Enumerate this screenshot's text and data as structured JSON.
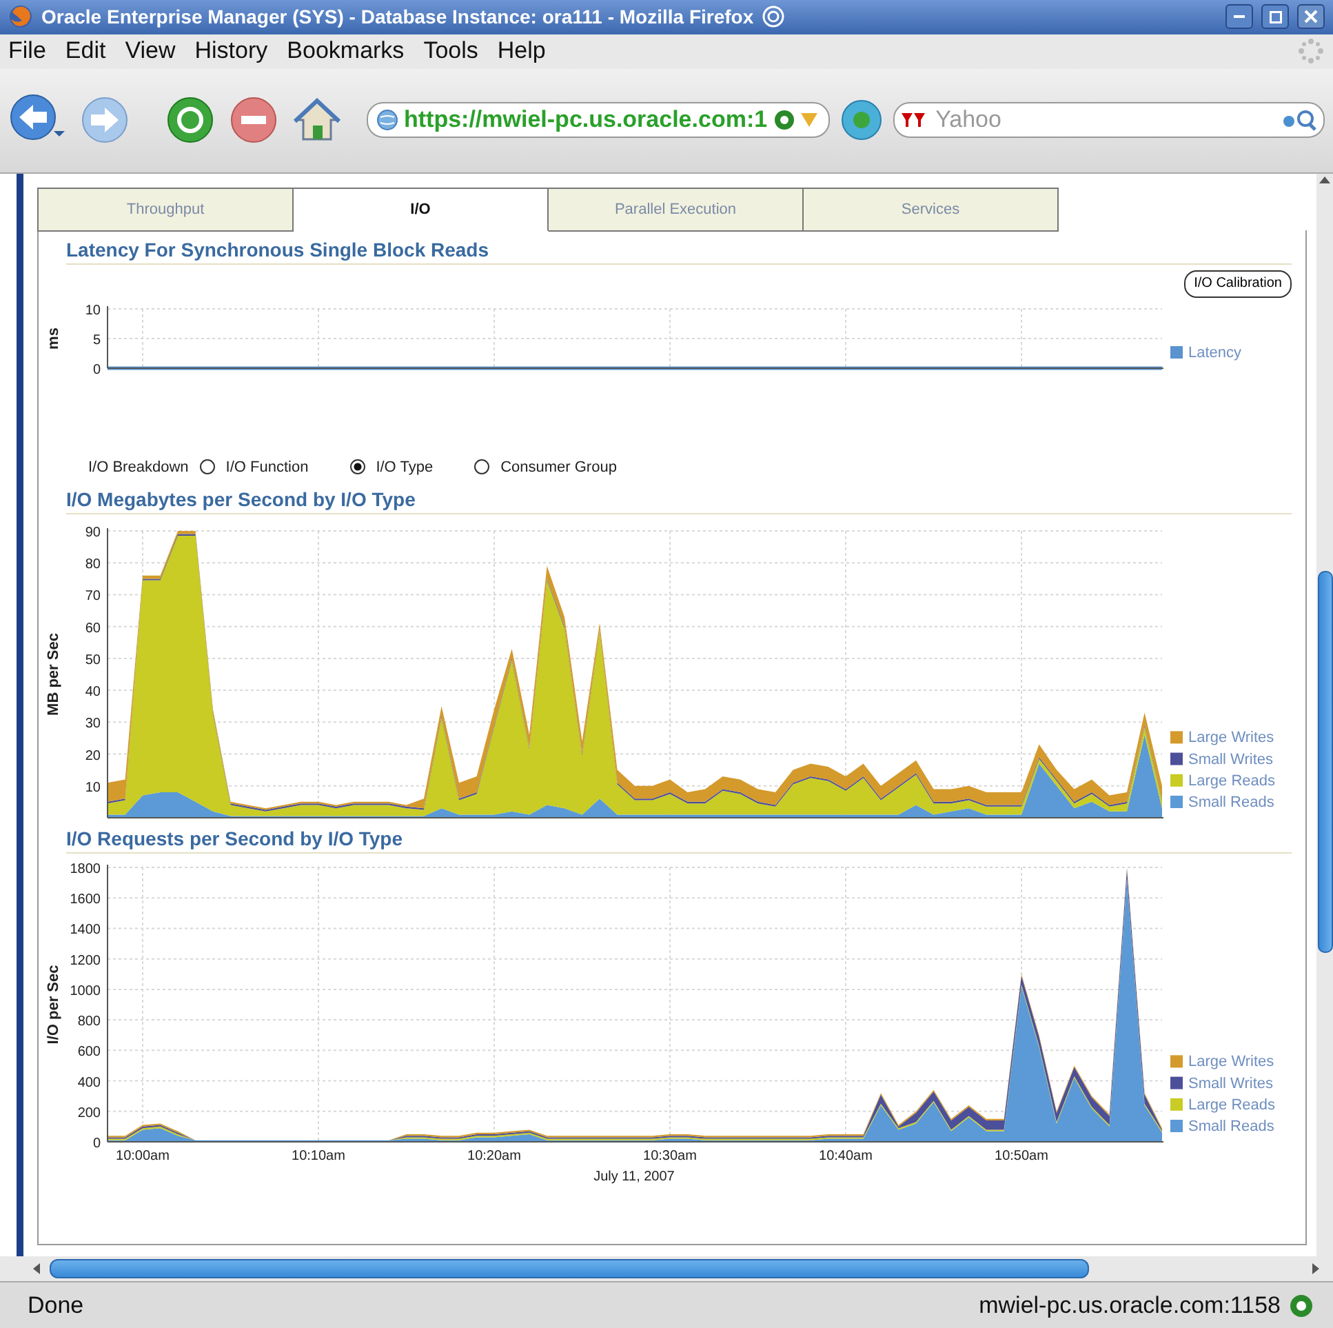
{
  "window": {
    "title": "Oracle Enterprise Manager (SYS) - Database Instance: ora111 - Mozilla Firefox"
  },
  "menu": [
    "File",
    "Edit",
    "View",
    "History",
    "Bookmarks",
    "Tools",
    "Help"
  ],
  "toolbar": {
    "url": "https://mwiel-pc.us.oracle.com:1",
    "search": {
      "placeholder": "Yahoo"
    }
  },
  "tabs": [
    {
      "label": "Throughput",
      "selected": false
    },
    {
      "label": "I/O",
      "selected": true
    },
    {
      "label": "Parallel Execution",
      "selected": false
    },
    {
      "label": "Services",
      "selected": false
    }
  ],
  "latency": {
    "title": "Latency For Synchronous Single Block Reads",
    "button": "I/O Calibration",
    "chart_data": {
      "type": "line",
      "ylabel": "ms",
      "categories": [
        null,
        null,
        null,
        null,
        null,
        null,
        null,
        null,
        null,
        null,
        null,
        null,
        null,
        null,
        null,
        null,
        null,
        null,
        null,
        null,
        null,
        null,
        null,
        null,
        null,
        null,
        null,
        null,
        null,
        null,
        null,
        null,
        null,
        null,
        null,
        null,
        null,
        null,
        null,
        null,
        null,
        null,
        null,
        null,
        null,
        null,
        null,
        null,
        null,
        null,
        null,
        null,
        null,
        null,
        null,
        null,
        null,
        null,
        null,
        null,
        null
      ],
      "ylim": [
        0,
        10
      ],
      "yticks": [
        0,
        5,
        10
      ],
      "grid": true,
      "legend": true,
      "series": [
        {
          "name": "Latency",
          "color": "#5b93d0",
          "values": [
            0,
            0,
            0,
            0,
            0,
            0,
            0,
            0,
            0,
            0,
            0,
            0,
            0,
            0,
            0,
            0,
            0,
            0,
            0,
            0,
            0,
            0,
            0,
            0,
            0,
            0,
            0,
            0,
            0,
            0,
            0,
            0,
            0,
            0,
            0,
            0,
            0,
            0,
            0,
            0,
            0,
            0,
            0,
            0,
            0,
            0,
            0,
            0,
            0,
            0,
            0,
            0,
            0,
            0,
            0,
            0,
            0,
            0,
            0,
            0,
            0
          ]
        }
      ]
    }
  },
  "breakdown": {
    "label": "I/O Breakdown",
    "options": [
      {
        "label": "I/O Function",
        "selected": false
      },
      {
        "label": "I/O Type",
        "selected": true
      },
      {
        "label": "Consumer Group",
        "selected": false
      }
    ]
  },
  "megabytes": {
    "title": "I/O Megabytes per Second by I/O Type",
    "chart_data": {
      "type": "area",
      "stacked": true,
      "ylabel": "MB per Sec",
      "ylim": [
        0,
        90
      ],
      "yticks": [
        10,
        20,
        30,
        40,
        50,
        60,
        70,
        80,
        90
      ],
      "grid": true,
      "legend": true,
      "categories": [
        null,
        null,
        null,
        null,
        null,
        null,
        null,
        null,
        null,
        null,
        null,
        null,
        null,
        null,
        null,
        null,
        null,
        null,
        null,
        null,
        null,
        null,
        null,
        null,
        null,
        null,
        null,
        null,
        null,
        null,
        null,
        null,
        null,
        null,
        null,
        null,
        null,
        null,
        null,
        null,
        null,
        null,
        null,
        null,
        null,
        null,
        null,
        null,
        null,
        null,
        null,
        null,
        null,
        null,
        null,
        null,
        null,
        null,
        null,
        null,
        null
      ],
      "series": [
        {
          "name": "Small Reads",
          "color": "#5b9ad6",
          "values": [
            1,
            1,
            7,
            8,
            8,
            5,
            2,
            0.5,
            0.5,
            0.5,
            0.5,
            0.5,
            0.5,
            0.5,
            0.5,
            0.5,
            0.5,
            0.5,
            0.5,
            3,
            1,
            1,
            1,
            2,
            1,
            4,
            3,
            1,
            6,
            1,
            1,
            1,
            1,
            1,
            1,
            1,
            1,
            1,
            1,
            1,
            1,
            1,
            1,
            1,
            1,
            1,
            4,
            1,
            2,
            3,
            1,
            1,
            1,
            17,
            10,
            3,
            5,
            2,
            2,
            26,
            3
          ]
        },
        {
          "name": "Large Reads",
          "color": "#c8cc24",
          "values": [
            3.5,
            4.5,
            67.5,
            66.5,
            80.5,
            83.5,
            30.5,
            3.5,
            2.5,
            1.5,
            2.5,
            3.5,
            3.5,
            2.5,
            3.5,
            3.5,
            3.5,
            2.5,
            2,
            28.5,
            4.5,
            6.5,
            27.5,
            47.5,
            20.5,
            70.5,
            56.5,
            18.5,
            52.5,
            9.5,
            4.5,
            4.5,
            6.5,
            3.5,
            3.5,
            7.5,
            6.5,
            3.5,
            2.5,
            9.5,
            11.5,
            10.5,
            7.5,
            11.5,
            4.5,
            8.5,
            9.5,
            3.5,
            2.5,
            2.5,
            2.5,
            2.5,
            2.5,
            1.5,
            1.5,
            1.5,
            2.5,
            1.5,
            2.5,
            2.5,
            2.5
          ]
        },
        {
          "name": "Small Writes",
          "color": "#4c4f99",
          "values": [
            0.5,
            0.5,
            0.5,
            0.5,
            0.5,
            0.5,
            0.5,
            0.5,
            0.5,
            0.5,
            0.5,
            0.5,
            0.5,
            0.5,
            0.5,
            0.5,
            0.5,
            0.5,
            0.5,
            0.5,
            0.5,
            0.5,
            0.5,
            0.5,
            0.5,
            0.5,
            0.5,
            0.5,
            0.5,
            0.5,
            0.5,
            0.5,
            0.5,
            0.5,
            0.5,
            0.5,
            0.5,
            0.5,
            0.5,
            0.5,
            0.5,
            0.5,
            0.5,
            0.5,
            0.5,
            0.5,
            0.5,
            0.5,
            0.5,
            0.5,
            0.5,
            0.5,
            0.5,
            0.5,
            0.5,
            0.5,
            0.5,
            0.5,
            0.5,
            0.5,
            0.5
          ]
        },
        {
          "name": "Large Writes",
          "color": "#d49a2c",
          "values": [
            6,
            6,
            1,
            1,
            1,
            1,
            1,
            0.5,
            0.5,
            0.5,
            0.5,
            0.5,
            0.5,
            0.5,
            0.5,
            0.5,
            0.5,
            0.5,
            3,
            3,
            5,
            5,
            5,
            3,
            4,
            4,
            3,
            4,
            2,
            4,
            4,
            4,
            4,
            3,
            4,
            4,
            4,
            4,
            4,
            4,
            4,
            4,
            4,
            4,
            4,
            4,
            4,
            4,
            4,
            4,
            4,
            4,
            4,
            4,
            3,
            4,
            4,
            3,
            3,
            4,
            4
          ]
        }
      ]
    }
  },
  "requests": {
    "title": "I/O Requests per Second by I/O Type",
    "chart_data": {
      "type": "area",
      "stacked": true,
      "ylabel": "I/O per Sec",
      "xlabel": "July 11, 2007",
      "ylim": [
        0,
        1800
      ],
      "yticks": [
        0,
        200,
        400,
        600,
        800,
        1000,
        1200,
        1400,
        1600,
        1800
      ],
      "grid": true,
      "legend": true,
      "categories": [
        null,
        null,
        "10:00am",
        null,
        null,
        null,
        null,
        null,
        null,
        null,
        null,
        null,
        "10:10am",
        null,
        null,
        null,
        null,
        null,
        null,
        null,
        null,
        null,
        "10:20am",
        null,
        null,
        null,
        null,
        null,
        null,
        null,
        null,
        null,
        "10:30am",
        null,
        null,
        null,
        null,
        null,
        null,
        null,
        null,
        null,
        "10:40am",
        null,
        null,
        null,
        null,
        null,
        null,
        null,
        null,
        null,
        "10:50am",
        null,
        null,
        null,
        null,
        null,
        null,
        null,
        null
      ],
      "series": [
        {
          "name": "Small Reads",
          "color": "#5b9ad6",
          "values": [
            10,
            10,
            80,
            90,
            40,
            10,
            10,
            10,
            10,
            10,
            10,
            10,
            10,
            10,
            10,
            10,
            10,
            20,
            20,
            10,
            10,
            30,
            30,
            40,
            50,
            10,
            10,
            10,
            10,
            10,
            10,
            10,
            20,
            20,
            10,
            10,
            10,
            10,
            10,
            10,
            10,
            20,
            20,
            20,
            240,
            80,
            120,
            260,
            70,
            160,
            70,
            70,
            1020,
            620,
            120,
            420,
            220,
            100,
            1720,
            240,
            60
          ]
        },
        {
          "name": "Large Reads",
          "color": "#c8cc24",
          "values": [
            10,
            10,
            10,
            10,
            10,
            0,
            0,
            0,
            0,
            0,
            0,
            0,
            0,
            0,
            0,
            0,
            0,
            10,
            10,
            10,
            10,
            10,
            10,
            10,
            10,
            10,
            10,
            10,
            10,
            10,
            10,
            10,
            10,
            10,
            10,
            10,
            10,
            10,
            10,
            10,
            10,
            10,
            10,
            10,
            10,
            10,
            10,
            10,
            10,
            10,
            10,
            10,
            10,
            10,
            10,
            10,
            10,
            10,
            10,
            10,
            10
          ]
        },
        {
          "name": "Small Writes",
          "color": "#4c4f99",
          "values": [
            10,
            10,
            10,
            10,
            10,
            0,
            0,
            0,
            0,
            0,
            0,
            0,
            0,
            0,
            0,
            0,
            0,
            10,
            10,
            10,
            10,
            10,
            10,
            10,
            10,
            10,
            10,
            10,
            10,
            10,
            10,
            10,
            10,
            10,
            10,
            10,
            10,
            10,
            10,
            10,
            10,
            10,
            10,
            10,
            60,
            10,
            60,
            60,
            60,
            60,
            60,
            60,
            60,
            60,
            60,
            60,
            60,
            60,
            60,
            60,
            10
          ]
        },
        {
          "name": "Large Writes",
          "color": "#d49a2c",
          "values": [
            10,
            10,
            10,
            10,
            10,
            0,
            0,
            0,
            0,
            0,
            0,
            0,
            0,
            0,
            0,
            0,
            0,
            10,
            10,
            10,
            10,
            10,
            10,
            10,
            10,
            10,
            10,
            10,
            10,
            10,
            10,
            10,
            10,
            10,
            10,
            10,
            10,
            10,
            10,
            10,
            10,
            10,
            10,
            10,
            10,
            10,
            10,
            10,
            10,
            10,
            10,
            10,
            10,
            10,
            10,
            10,
            10,
            10,
            10,
            10,
            10
          ]
        }
      ]
    }
  },
  "status_bar": {
    "text": "Done",
    "host": "mwiel-pc.us.oracle.com:1158"
  }
}
